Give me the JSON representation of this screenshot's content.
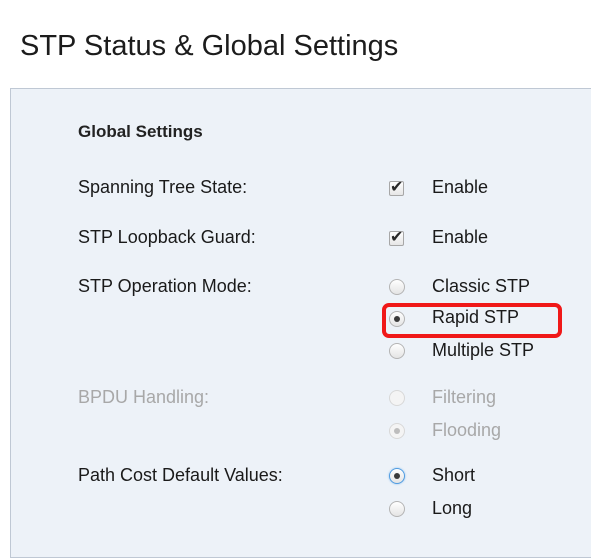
{
  "page": {
    "title": "STP Status & Global Settings"
  },
  "global_settings": {
    "title": "Global Settings",
    "spanning_tree_state": {
      "label": "Spanning Tree State:",
      "option": "Enable",
      "checked": true
    },
    "stp_loopback_guard": {
      "label": "STP Loopback Guard:",
      "option": "Enable",
      "checked": true
    },
    "stp_operation_mode": {
      "label": "STP Operation Mode:",
      "options": [
        "Classic STP",
        "Rapid STP",
        "Multiple STP"
      ],
      "selected": "Rapid STP"
    },
    "bpdu_handling": {
      "label": "BPDU Handling:",
      "options": [
        "Filtering",
        "Flooding"
      ],
      "selected": "Flooding",
      "disabled": true
    },
    "path_cost_default_values": {
      "label": "Path Cost Default Values:",
      "options": [
        "Short",
        "Long"
      ],
      "selected": "Short"
    }
  },
  "colors": {
    "panel_background": "#edf2f8",
    "highlight": "#f01818",
    "disabled_text": "#a8a8a8"
  }
}
